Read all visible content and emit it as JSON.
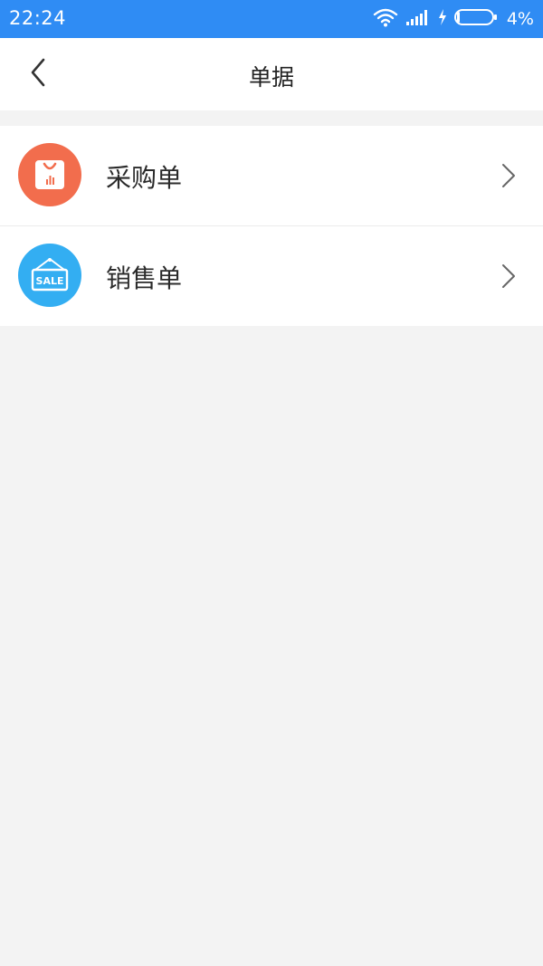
{
  "status_bar": {
    "time": "22:24",
    "battery_percent": "4%",
    "icons": [
      "wifi-icon",
      "signal-icon",
      "charging-icon",
      "battery-icon"
    ]
  },
  "header": {
    "title": "单据",
    "back_icon": "chevron-left-icon"
  },
  "list": {
    "items": [
      {
        "label": "采购单",
        "icon": "shopping-bag-icon",
        "icon_color": "#f26d4d",
        "chevron": "chevron-right-icon"
      },
      {
        "label": "销售单",
        "icon": "sale-sign-icon",
        "icon_text": "SALE",
        "icon_color": "#33aef2",
        "chevron": "chevron-right-icon"
      }
    ]
  },
  "colors": {
    "status_bar": "#2f8cf4",
    "background": "#f3f3f3",
    "card": "#ffffff"
  }
}
